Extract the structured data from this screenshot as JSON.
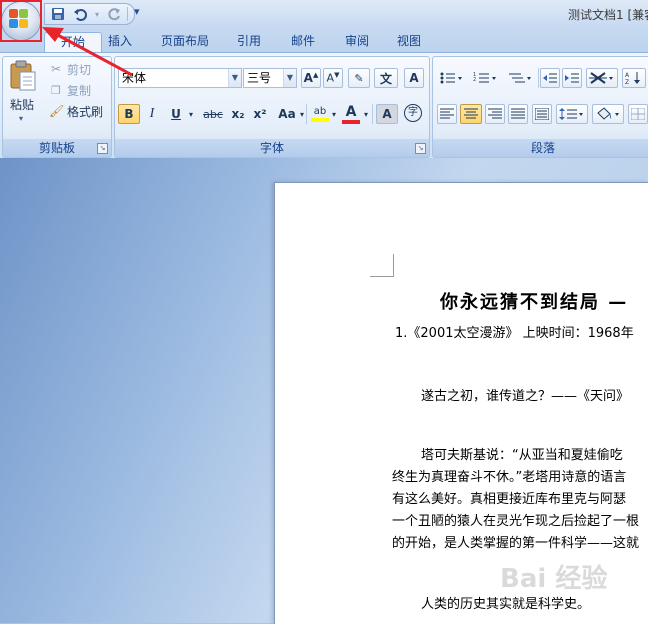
{
  "title_bar": {
    "document_title": "测试文档1 [兼容"
  },
  "quick_access": {
    "save_icon": "save-icon",
    "undo_icon": "undo-icon",
    "redo_icon": "redo-icon",
    "more": "▾"
  },
  "tabs": [
    {
      "label": "开始",
      "active": true
    },
    {
      "label": "插入"
    },
    {
      "label": "页面布局"
    },
    {
      "label": "引用"
    },
    {
      "label": "邮件"
    },
    {
      "label": "审阅"
    },
    {
      "label": "视图"
    }
  ],
  "clipboard": {
    "group_label": "剪贴板",
    "paste": "粘贴",
    "cut": "剪切",
    "copy": "复制",
    "format_painter": "格式刷"
  },
  "font": {
    "group_label": "字体",
    "font_name": "宋体",
    "font_size": "三号",
    "bold": "B",
    "italic": "I",
    "underline": "U",
    "strike": "abc",
    "subscript": "x₂",
    "superscript": "x²",
    "change_case": "Aa",
    "font_color_label": "A",
    "highlight_label": "ab",
    "wen": "文",
    "char_border": "A",
    "char_shading": "A",
    "phonetic": "字"
  },
  "paragraph": {
    "group_label": "段落"
  },
  "document": {
    "heading": "你永远猜不到结局 —",
    "line1": "1.《2001太空漫游》 上映时间：1968年",
    "line2": "遂古之初，谁传道之？——《天问》",
    "para1_line1": "塔可夫斯基说：“从亚当和夏娃偷吃",
    "para1_line2": "终生为真理奋斗不休。”老塔用诗意的语言",
    "para1_line3": "有这么美好。真相更接近库布里克与阿瑟",
    "para1_line4": "一个丑陋的猿人在灵光乍现之后捡起了一根",
    "para1_line5": "的开始，是人类掌握的第一件科学——这就",
    "line_last": "人类的历史其实就是科学史。"
  },
  "colors": {
    "accent_red": "#e8232c",
    "ribbon_text": "#15428b",
    "font_color_bar": "#e8232c",
    "highlight_bar": "#ffff00"
  },
  "watermark": "Bai 经验"
}
